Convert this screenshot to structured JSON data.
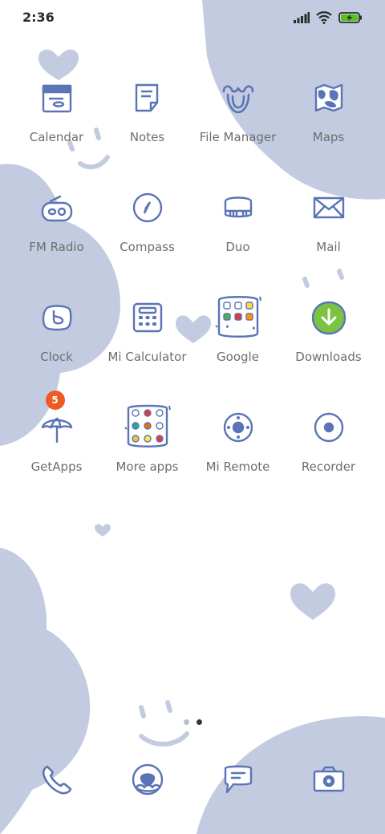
{
  "status": {
    "time": "2:36"
  },
  "apps": [
    {
      "label": "Calendar",
      "icon": "calendar-icon"
    },
    {
      "label": "Notes",
      "icon": "notes-icon"
    },
    {
      "label": "File Manager",
      "icon": "file-manager-icon"
    },
    {
      "label": "Maps",
      "icon": "maps-icon"
    },
    {
      "label": "FM Radio",
      "icon": "radio-icon"
    },
    {
      "label": "Compass",
      "icon": "compass-icon"
    },
    {
      "label": "Duo",
      "icon": "duo-icon"
    },
    {
      "label": "Mail",
      "icon": "mail-icon"
    },
    {
      "label": "Clock",
      "icon": "clock-icon"
    },
    {
      "label": "Mi Calculator",
      "icon": "calculator-icon"
    },
    {
      "label": "Google",
      "icon": "google-folder-icon"
    },
    {
      "label": "Downloads",
      "icon": "download-icon"
    },
    {
      "label": "GetApps",
      "icon": "umbrella-icon",
      "badge": "5"
    },
    {
      "label": "More apps",
      "icon": "more-apps-folder-icon"
    },
    {
      "label": "Mi Remote",
      "icon": "remote-icon"
    },
    {
      "label": "Recorder",
      "icon": "recorder-icon"
    }
  ],
  "dock": [
    {
      "icon": "phone-icon"
    },
    {
      "icon": "contacts-icon"
    },
    {
      "icon": "messages-icon"
    },
    {
      "icon": "camera-icon"
    }
  ],
  "pager": {
    "count": 2,
    "active": 1
  },
  "colors": {
    "accent": "#5b74b5",
    "wallpaper_blob": "#c3cbe1",
    "badge": "#ee5a24",
    "download_green": "#7cc341"
  }
}
